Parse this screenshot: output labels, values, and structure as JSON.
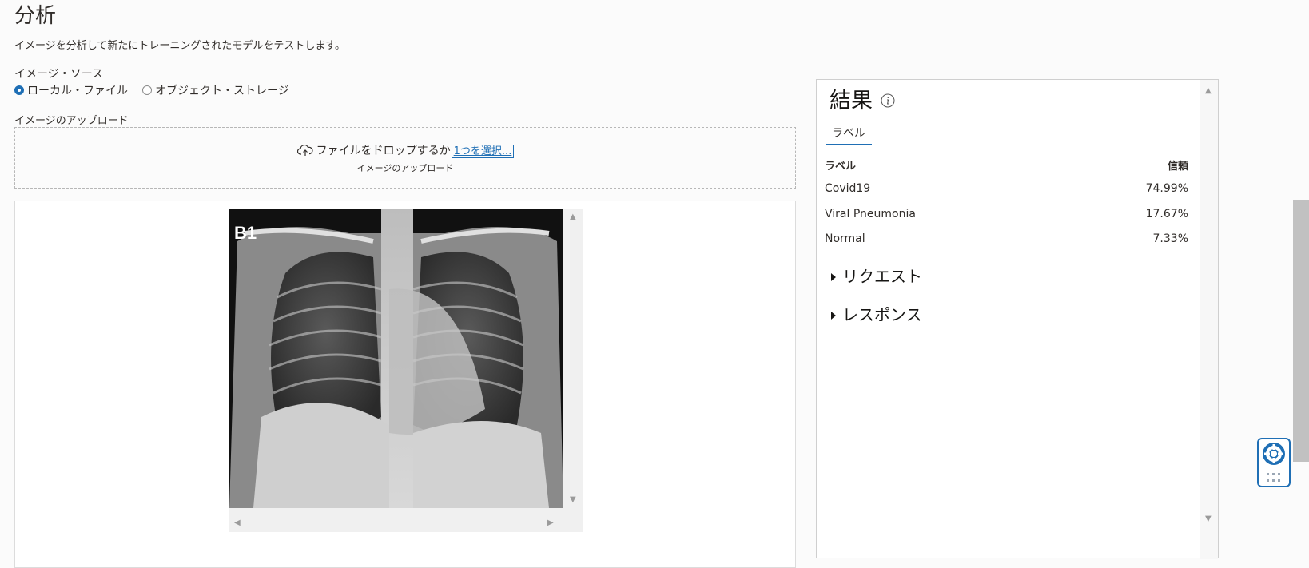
{
  "page": {
    "title": "分析",
    "description": "イメージを分析して新たにトレーニングされたモデルをテストします。"
  },
  "image_source": {
    "label": "イメージ・ソース",
    "options": [
      "ローカル・ファイル",
      "オブジェクト・ストレージ"
    ],
    "selected": "ローカル・ファイル"
  },
  "upload": {
    "label": "イメージのアップロード",
    "drop_text": "ファイルをドロップするか",
    "select_link": "1つを選択...",
    "sub_text": "イメージのアップロード"
  },
  "preview": {
    "image_label": "B1",
    "image_description_icon": "chest-xray-image"
  },
  "results": {
    "title": "結果",
    "tab": "ラベル",
    "col_label": "ラベル",
    "col_confidence": "信頼",
    "rows": [
      {
        "label": "Covid19",
        "confidence": "74.99%"
      },
      {
        "label": "Viral Pneumonia",
        "confidence": "17.67%"
      },
      {
        "label": "Normal",
        "confidence": "7.33%"
      }
    ],
    "request": "リクエスト",
    "response": "レスポンス"
  },
  "icons": {
    "info": "info-icon",
    "upload": "cloud-upload-icon",
    "help": "lifebuoy-icon"
  },
  "colors": {
    "accent": "#1f6fb5",
    "text": "#312d2a"
  }
}
